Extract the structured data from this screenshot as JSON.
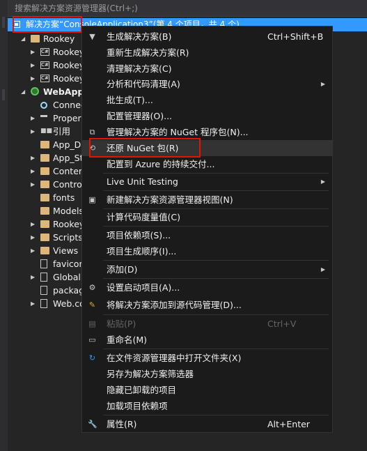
{
  "search": {
    "placeholder": "搜索解决方案资源管理器(Ctrl+;)"
  },
  "solution": {
    "label": "解决方案“ConsoleApplication3”(第 4 个项目，共 4 个)"
  },
  "tree": {
    "items": [
      {
        "label": "Rookey",
        "icon": "folder-icon"
      },
      {
        "label": "Rookey",
        "icon": "csharp-project-icon"
      },
      {
        "label": "Rookey",
        "icon": "csharp-project-icon"
      },
      {
        "label": "Rookey",
        "icon": "csharp-project-icon"
      },
      {
        "label": "WebApp",
        "icon": "web-project-icon"
      },
      {
        "label": "Connected",
        "icon": "connected-services-icon"
      },
      {
        "label": "Properties",
        "icon": "wrench-icon"
      },
      {
        "label": "引用",
        "icon": "references-icon"
      },
      {
        "label": "App_Data",
        "icon": "folder-icon"
      },
      {
        "label": "App_Start",
        "icon": "folder-icon"
      },
      {
        "label": "Content",
        "icon": "folder-icon"
      },
      {
        "label": "Controllers",
        "icon": "folder-icon"
      },
      {
        "label": "fonts",
        "icon": "folder-icon"
      },
      {
        "label": "Models",
        "icon": "folder-icon"
      },
      {
        "label": "Rookey",
        "icon": "folder-icon"
      },
      {
        "label": "Scripts",
        "icon": "folder-icon"
      },
      {
        "label": "Views",
        "icon": "folder-icon"
      },
      {
        "label": "favicon",
        "icon": "file-icon"
      },
      {
        "label": "Global",
        "icon": "file-icon"
      },
      {
        "label": "packages",
        "icon": "file-icon"
      },
      {
        "label": "Web.config",
        "icon": "file-icon"
      }
    ]
  },
  "menu": {
    "build": {
      "label": "生成解决方案(B)",
      "shortcut": "Ctrl+Shift+B"
    },
    "rebuild": {
      "label": "重新生成解决方案(R)"
    },
    "clean": {
      "label": "清理解决方案(C)"
    },
    "analyze": {
      "label": "分析和代码清理(A)"
    },
    "batch_build": {
      "label": "批生成(T)..."
    },
    "config_manager": {
      "label": "配置管理器(O)..."
    },
    "manage_nuget": {
      "label": "管理解决方案的 NuGet 程序包(N)..."
    },
    "restore_nuget": {
      "label": "还原 NuGet 包(R)"
    },
    "azure_delivery": {
      "label": "配置到 Azure 的持续交付..."
    },
    "live_unit_testing": {
      "label": "Live Unit Testing"
    },
    "new_view": {
      "label": "新建解决方案资源管理器视图(N)"
    },
    "code_metrics": {
      "label": "计算代码度量值(C)"
    },
    "project_deps": {
      "label": "项目依赖项(S)..."
    },
    "build_order": {
      "label": "项目生成顺序(I)..."
    },
    "add": {
      "label": "添加(D)"
    },
    "startup_projects": {
      "label": "设置启动项目(A)..."
    },
    "add_source_control": {
      "label": "将解决方案添加到源代码管理(D)..."
    },
    "paste": {
      "label": "粘贴(P)",
      "shortcut": "Ctrl+V"
    },
    "rename": {
      "label": "重命名(M)"
    },
    "open_folder": {
      "label": "在文件资源管理器中打开文件夹(X)"
    },
    "save_filter": {
      "label": "另存为解决方案筛选器"
    },
    "hide_unloaded": {
      "label": "隐藏已卸载的项目"
    },
    "load_deps": {
      "label": "加载项目依赖项"
    },
    "properties": {
      "label": "属性(R)",
      "shortcut": "Alt+Enter"
    }
  },
  "colors": {
    "selection": "#3399ff",
    "highlight_box": "#e51400",
    "menu_bg": "#1b1b1c",
    "panel_bg": "#252526"
  }
}
